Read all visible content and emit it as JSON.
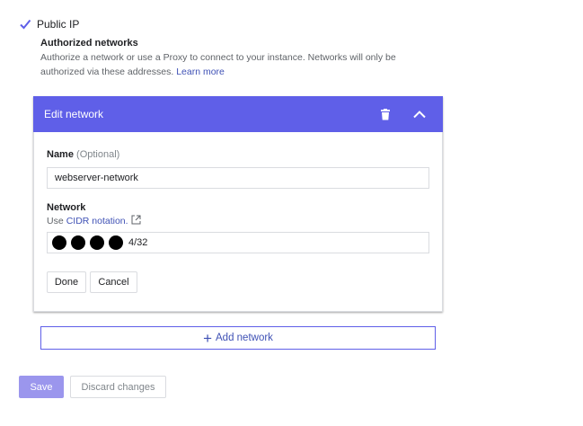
{
  "public_ip": {
    "label": "Public IP",
    "checked": true
  },
  "authorized_networks": {
    "title": "Authorized networks",
    "description": "Authorize a network or use a Proxy to connect to your instance. Networks will only be authorized via these addresses.",
    "learn_more": "Learn more"
  },
  "edit_panel": {
    "title": "Edit network",
    "name_label": "Name",
    "name_optional": "(Optional)",
    "name_value": "webserver-network",
    "network_label": "Network",
    "network_hint_prefix": "Use",
    "network_hint_link": "CIDR notation.",
    "network_value": "4/32",
    "done_label": "Done",
    "cancel_label": "Cancel"
  },
  "add_network_label": "Add network",
  "footer": {
    "save_label": "Save",
    "discard_label": "Discard changes"
  },
  "colors": {
    "accent": "#5f5fe8",
    "link": "#3f51b5",
    "save_disabled": "#9b96ed"
  }
}
